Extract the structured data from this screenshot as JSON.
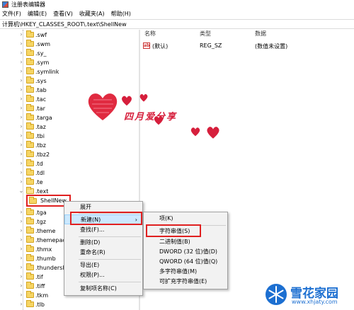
{
  "window": {
    "title": "注册表编辑器"
  },
  "menubar": {
    "items": [
      "文件(F)",
      "编辑(E)",
      "查看(V)",
      "收藏夹(A)",
      "帮助(H)"
    ]
  },
  "address": {
    "path": "计算机\\HKEY_CLASSES_ROOT\\.text\\ShellNew"
  },
  "tree": {
    "items": [
      ".swf",
      ".swm",
      ".sy_",
      ".sym",
      ".symlink",
      ".sys",
      ".tab",
      ".tac",
      ".tar",
      ".targa",
      ".taz",
      ".tbi",
      ".tbz",
      ".tbz2",
      ".td",
      ".tdl",
      ".te",
      ".text",
      "ShellNew",
      ".tga",
      ".tgz",
      ".theme",
      ".themepack",
      ".thmx",
      ".thumb",
      ".thunderski",
      ".tif",
      ".tiff",
      ".tkm",
      ".tlb"
    ]
  },
  "values": {
    "headers": {
      "name": "名称",
      "type": "类型",
      "data": "数据"
    },
    "rows": [
      {
        "name": "(默认)",
        "type": "REG_SZ",
        "data": "(数值未设置)"
      }
    ]
  },
  "context_menu": {
    "items": [
      "展开",
      "新建(N)",
      "查找(F)...",
      "删除(D)",
      "重命名(R)",
      "导出(E)",
      "权限(P)...",
      "复制项名称(C)"
    ]
  },
  "submenu": {
    "items": [
      "项(K)",
      "字符串值(S)",
      "二进制值(B)",
      "DWORD (32 位)值(D)",
      "QWORD (64 位)值(Q)",
      "多字符串值(M)",
      "可扩充字符串值(E)"
    ]
  },
  "decoration": {
    "text": "四月爱分享"
  },
  "watermark": {
    "name": "雪花家园",
    "url": "www.xhjaty.com"
  },
  "colors": {
    "highlight_red": "#e02020",
    "heart_red": "#d61f3c",
    "watermark_blue": "#1c6fd1"
  }
}
